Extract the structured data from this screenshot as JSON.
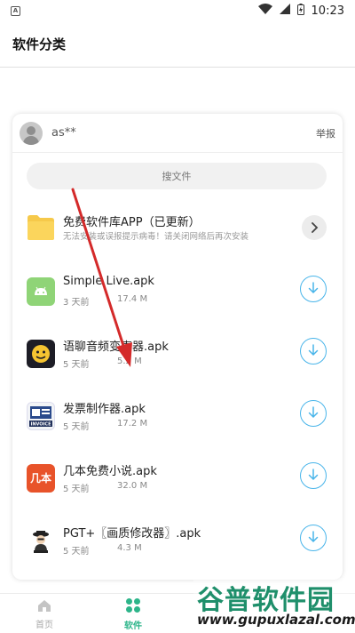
{
  "status_bar": {
    "app_badge": "A",
    "time": "10:23"
  },
  "header": {
    "title": "软件分类"
  },
  "card": {
    "username": "as**",
    "report_label": "举报",
    "search_placeholder": "搜文件",
    "folder": {
      "name": "免费软件库APP（已更新）",
      "description": "无法安装或误报提示病毒！请关闭网络后再次安装"
    },
    "files": [
      {
        "name": "Simple Live.apk",
        "age": "3 天前",
        "size": "17.4 M",
        "icon": "android-icon"
      },
      {
        "name": "语聊音频变声器.apk",
        "age": "5 天前",
        "size": "5.2 M",
        "icon": "voice-changer-app-icon"
      },
      {
        "name": "发票制作器.apk",
        "age": "5 天前",
        "size": "17.2 M",
        "icon": "invoice-app-icon"
      },
      {
        "name": "几本免费小说.apk",
        "age": "5 天前",
        "size": "32.0 M",
        "icon": "novel-app-icon"
      },
      {
        "name": "PGT+〖画质修改器〗.apk",
        "age": "5 天前",
        "size": "4.3 M",
        "icon": "pgt-app-icon"
      }
    ],
    "icon_texts": {
      "invoice": "INVOICE",
      "novel": "几本"
    }
  },
  "bottom_nav": {
    "items": [
      {
        "label": "首页",
        "active": false
      },
      {
        "label": "软件",
        "active": true
      }
    ]
  },
  "watermark": {
    "title": "谷普软件园",
    "url": "www.gupuxlazal.com"
  },
  "colors": {
    "accent_green": "#2db58a",
    "download_blue": "#49b5ea",
    "annotation_red": "#d42a2a"
  }
}
